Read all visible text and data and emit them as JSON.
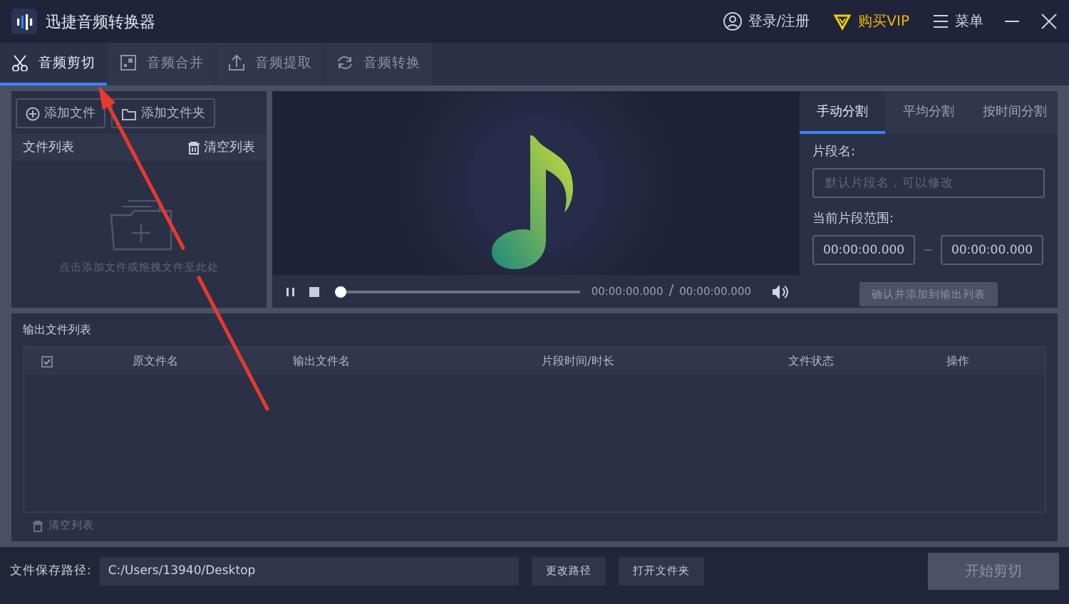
{
  "window": {
    "title": "迅捷音频转换器",
    "login": "登录/注册",
    "vip": "购买VIP",
    "menu": "菜单"
  },
  "tabs": [
    {
      "label": "音频剪切",
      "selected": true
    },
    {
      "label": "音频合并",
      "selected": false
    },
    {
      "label": "音频提取",
      "selected": false
    },
    {
      "label": "音频转换",
      "selected": false
    }
  ],
  "file_panel": {
    "add_file": "添加文件",
    "add_folder": "添加文件夹",
    "list_title": "文件列表",
    "clear": "清空列表",
    "hint": "点击添加文件或拖拽文件至此处"
  },
  "player": {
    "level": 0,
    "current": "00:00:00.000",
    "separator": "/",
    "total": "00:00:00.000"
  },
  "split_panel": {
    "tabs": [
      {
        "label": "手动分割",
        "selected": true
      },
      {
        "label": "平均分割",
        "selected": false
      },
      {
        "label": "按时间分割",
        "selected": false
      }
    ],
    "name_label": "片段名:",
    "name_placeholder": "默认片段名，可以修改",
    "range_label": "当前片段范围:",
    "start": "00:00:00.000",
    "end": "00:00:00.000",
    "confirm": {
      "label": "确认并添加到输出列表",
      "disabled": true
    }
  },
  "output": {
    "title": "输出文件列表",
    "select_all": {
      "checked": true
    },
    "columns": [
      "原文件名",
      "输出文件名",
      "片段时间/时长",
      "文件状态",
      "操作"
    ],
    "clear": "清空列表"
  },
  "footer": {
    "path_label": "文件保存路径:",
    "path": "C:/Users/13940/Desktop",
    "change": "更改路径",
    "open": "打开文件夹",
    "start": {
      "label": "开始剪切",
      "disabled": true
    }
  }
}
